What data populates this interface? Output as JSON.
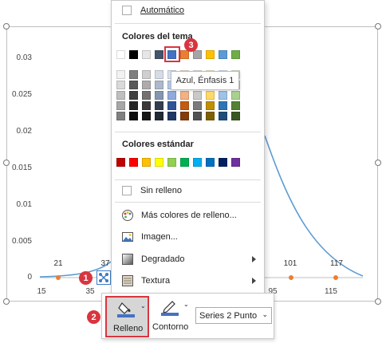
{
  "chart": {
    "y_ticks": [
      "0.03",
      "0.025",
      "0.02",
      "0.015",
      "0.01",
      "0.005",
      "0"
    ],
    "x_ticks": [
      "15",
      "35",
      "95",
      "115"
    ],
    "data_labels": [
      "21",
      "37",
      "101",
      "117"
    ],
    "curve_color": "#5b9bd5",
    "point_color": "#ed7d31"
  },
  "menu": {
    "automatic_label": "Automático",
    "theme_colors_title": "Colores del tema",
    "standard_colors_title": "Colores estándar",
    "no_fill_label": "Sin relleno",
    "more_colors_label": "Más colores de relleno...",
    "image_label": "Imagen...",
    "gradient_label": "Degradado",
    "texture_label": "Textura",
    "tooltip": "Azul, Énfasis 1",
    "theme_row": [
      "#ffffff",
      "#000000",
      "#e7e6e6",
      "#44546a",
      "#4472c4",
      "#ed7d31",
      "#a5a5a5",
      "#ffc000",
      "#5b9bd5",
      "#70ad47"
    ],
    "theme_shades": [
      [
        "#f2f2f2",
        "#d9d9d9",
        "#bfbfbf",
        "#a6a6a6",
        "#808080"
      ],
      [
        "#7f7f7f",
        "#595959",
        "#404040",
        "#262626",
        "#0d0d0d"
      ],
      [
        "#d0cece",
        "#aeabab",
        "#757171",
        "#3a3838",
        "#171616"
      ],
      [
        "#d6dce5",
        "#adb9ca",
        "#8497b0",
        "#333f50",
        "#222a35"
      ],
      [
        "#dae3f3",
        "#b4c7e7",
        "#8faadc",
        "#2f5597",
        "#1f3864"
      ],
      [
        "#fbe5d6",
        "#f8cbad",
        "#f4b183",
        "#c55a11",
        "#843c0c"
      ],
      [
        "#ededed",
        "#dbdbdb",
        "#c9c9c9",
        "#7b7b7b",
        "#525252"
      ],
      [
        "#fff2cc",
        "#ffe699",
        "#ffd966",
        "#bf9000",
        "#7f6000"
      ],
      [
        "#deebf7",
        "#bdd7ee",
        "#9dc3e6",
        "#2e75b6",
        "#1f4e79"
      ],
      [
        "#e2f0d9",
        "#c5e0b4",
        "#a9d18e",
        "#548235",
        "#385723"
      ]
    ],
    "standard_row": [
      "#c00000",
      "#ff0000",
      "#ffc000",
      "#ffff00",
      "#92d050",
      "#00b050",
      "#00b0f0",
      "#0070c0",
      "#002060",
      "#7030a0"
    ]
  },
  "toolbar": {
    "fill_label": "Relleno",
    "outline_label": "Contorno",
    "series_select_value": "Series 2 Punto"
  },
  "badges": {
    "one": "1",
    "two": "2",
    "three": "3"
  }
}
